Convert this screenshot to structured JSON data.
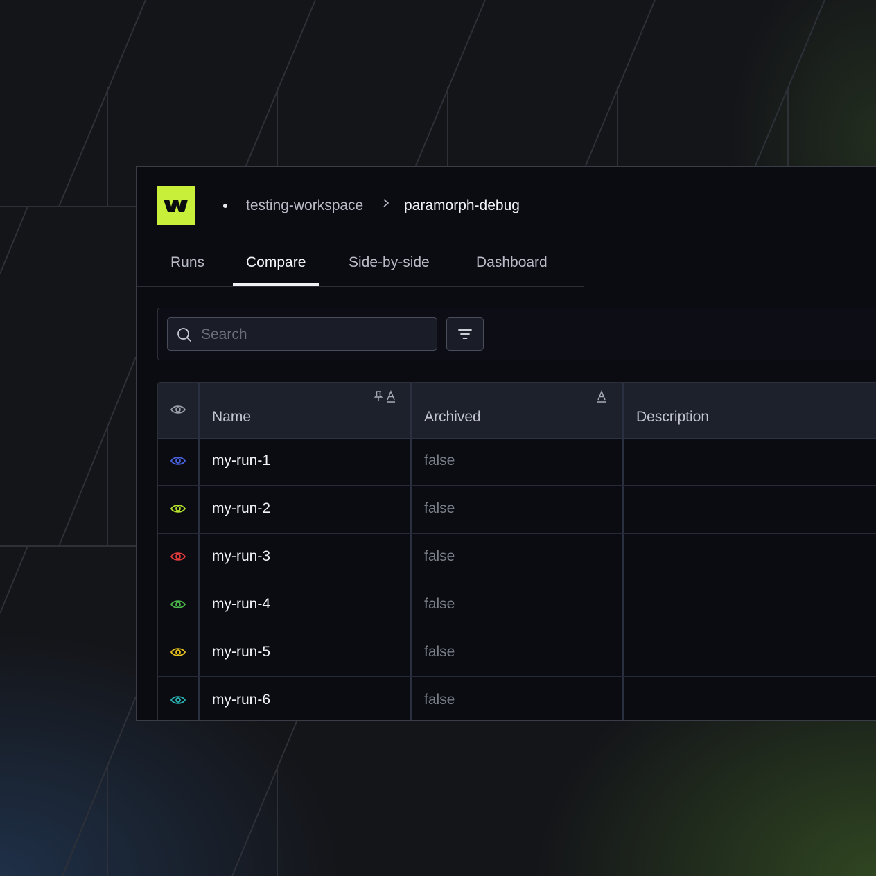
{
  "breadcrumb": {
    "workspace": "testing-workspace",
    "project": "paramorph-debug"
  },
  "tabs": [
    {
      "label": "Runs",
      "active": false
    },
    {
      "label": "Compare",
      "active": true
    },
    {
      "label": "Side-by-side",
      "active": false
    },
    {
      "label": "Dashboard",
      "active": false
    }
  ],
  "search": {
    "placeholder": "Search",
    "value": ""
  },
  "table": {
    "headers": {
      "name": "Name",
      "archived": "Archived",
      "description": "Description"
    },
    "rows": [
      {
        "name": "my-run-1",
        "archived": "false",
        "description": "",
        "color": "#4a63e0"
      },
      {
        "name": "my-run-2",
        "archived": "false",
        "description": "",
        "color": "#b4e12d"
      },
      {
        "name": "my-run-3",
        "archived": "false",
        "description": "",
        "color": "#e23b3b"
      },
      {
        "name": "my-run-4",
        "archived": "false",
        "description": "",
        "color": "#4cb84c"
      },
      {
        "name": "my-run-5",
        "archived": "false",
        "description": "",
        "color": "#e8c21e"
      },
      {
        "name": "my-run-6",
        "archived": "false",
        "description": "",
        "color": "#2ab3b3"
      }
    ]
  },
  "colors": {
    "brand": "#c8f03a",
    "header_eye": "#9aa0ab"
  }
}
